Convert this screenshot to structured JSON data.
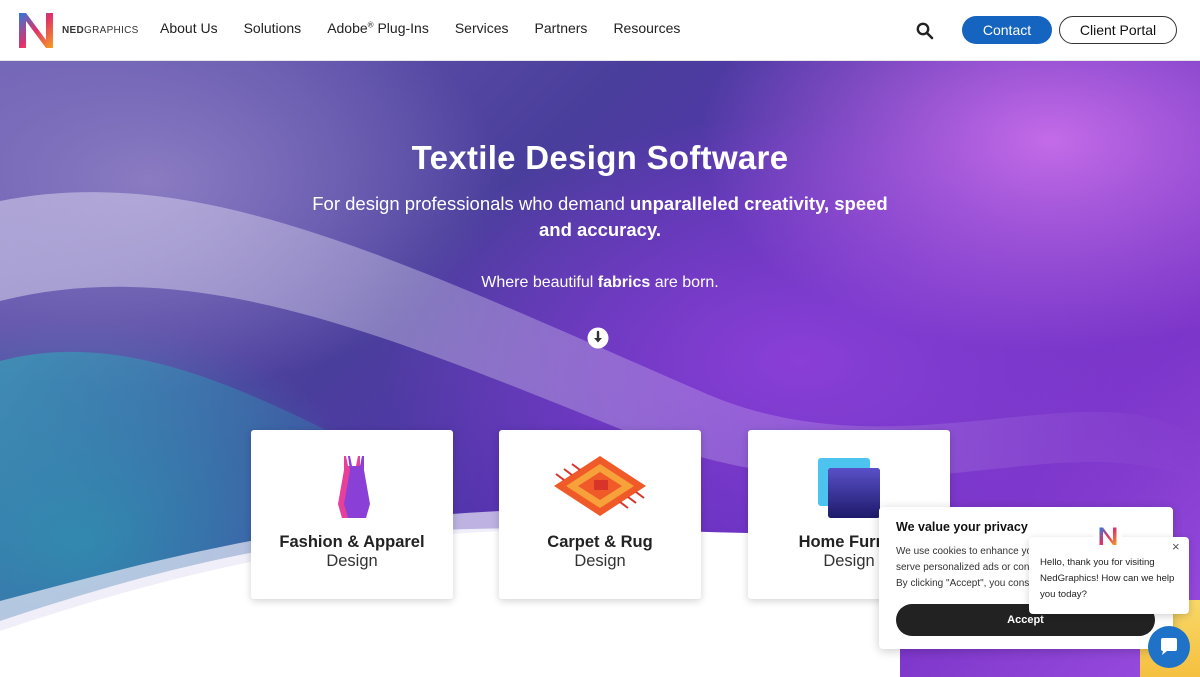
{
  "header": {
    "logo_brand_bold": "NED",
    "logo_brand_rest": "GRAPHICS",
    "nav": [
      {
        "label": "About Us"
      },
      {
        "label": "Solutions"
      },
      {
        "label": "Adobe",
        "sup": "®",
        "rest": " Plug-Ins"
      },
      {
        "label": "Services"
      },
      {
        "label": "Partners"
      },
      {
        "label": "Resources"
      }
    ],
    "contact_label": "Contact",
    "portal_label": "Client Portal"
  },
  "hero": {
    "title": "Textile Design Software",
    "subtitle_plain": "For design professionals who demand ",
    "subtitle_bold": "unparalleled creativity, speed and accuracy.",
    "tag_pre": "Where beautiful ",
    "tag_bold": "fabrics",
    "tag_post": " are born."
  },
  "cards": [
    {
      "title": "Fashion & Apparel",
      "sub": "Design",
      "icon": "dress-icon"
    },
    {
      "title": "Carpet & Rug",
      "sub": "Design",
      "icon": "rug-icon"
    },
    {
      "title": "Home Furnis",
      "sub": "Design",
      "icon": "pillow-icon"
    }
  ],
  "privacy": {
    "title": "We value your privacy",
    "line1": "We use cookies to enhance yo",
    "line2": "serve personalized ads or cont",
    "line3": "By clicking \"Accept\", you cons",
    "accept_label": "Accept"
  },
  "chat": {
    "message": "Hello, thank you for visiting NedGraphics! How can we help you today?",
    "close": "×"
  },
  "colors": {
    "accent": "#1565c0",
    "chat_launcher": "#1e72c8",
    "accept_bg": "#222222"
  }
}
